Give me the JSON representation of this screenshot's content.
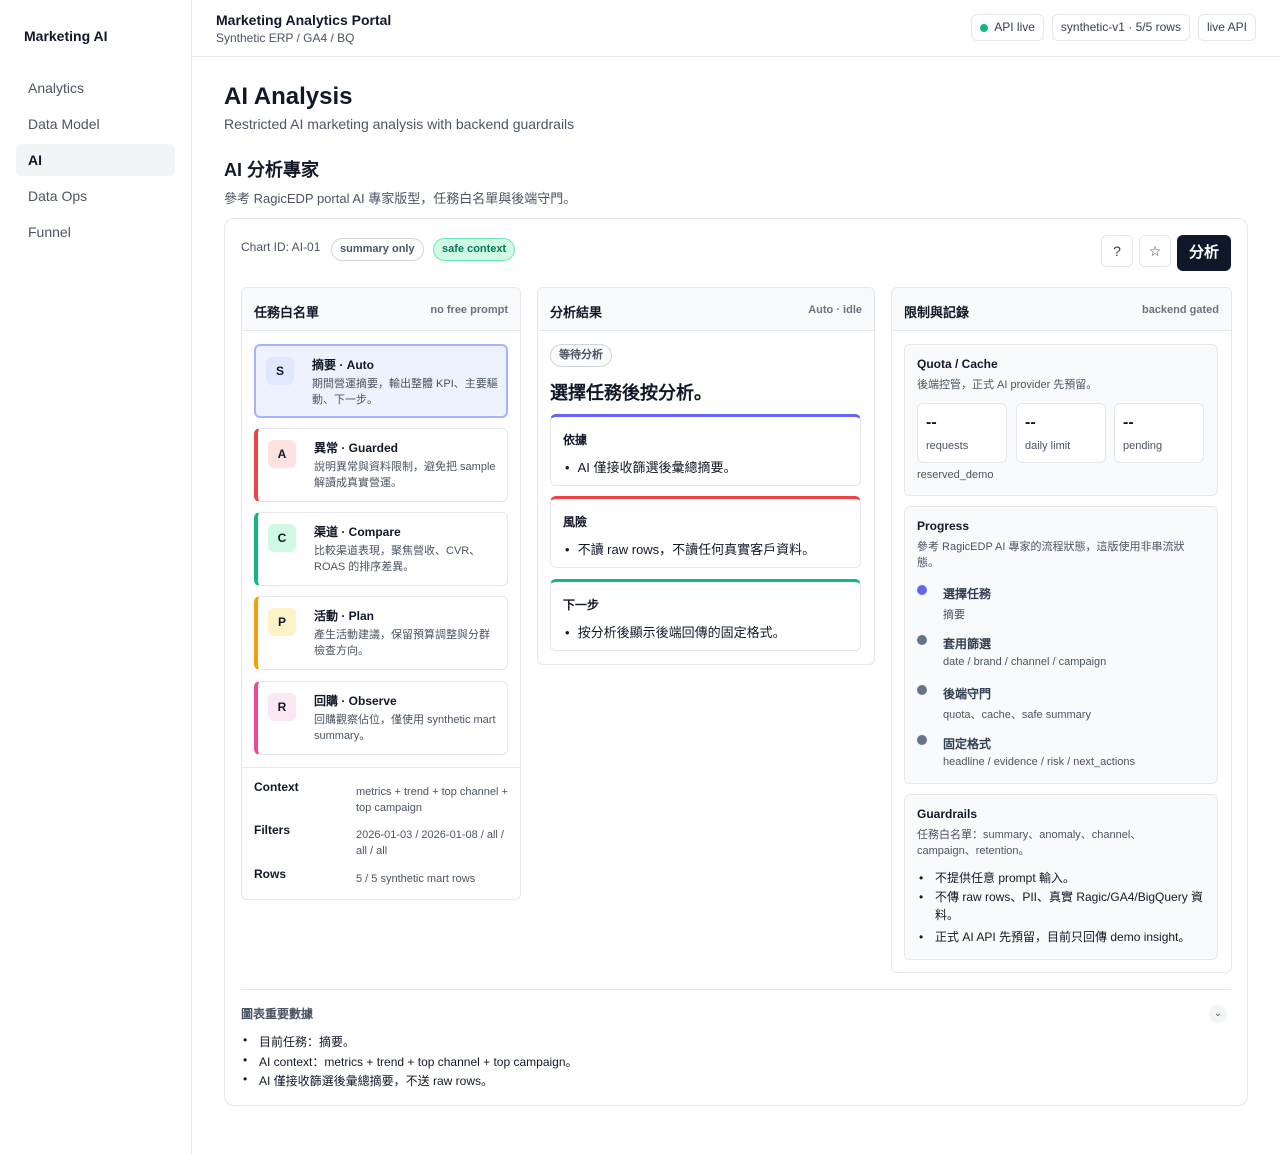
{
  "app": {
    "brand": "Marketing AI"
  },
  "sidebar": {
    "items": [
      {
        "label": "Analytics"
      },
      {
        "label": "Data Model"
      },
      {
        "label": "AI"
      },
      {
        "label": "Data Ops"
      },
      {
        "label": "Funnel"
      }
    ],
    "active_index": 2
  },
  "topbar": {
    "title": "Marketing Analytics Portal",
    "subtitle": "Synthetic ERP / GA4 / BQ",
    "status_live": "API live",
    "status_dataset": "synthetic-v1 · 5/5 rows",
    "status_mode": "live API",
    "live_color": "#10b981"
  },
  "page": {
    "title": "AI Analysis",
    "subtitle": "Restricted AI marketing analysis with backend guardrails",
    "section_title": "AI 分析專家",
    "section_subtitle": "參考 RagicEDP portal AI 專家版型，任務白名單與後端守門。"
  },
  "card": {
    "chart_id": "Chart ID: AI-01",
    "pill_summary": "summary only",
    "pill_safe": "safe context",
    "help_icon": "?",
    "star_icon": "☆",
    "analyze_label": "分析"
  },
  "tasks": {
    "title": "任務白名單",
    "hint": "no free prompt",
    "items": [
      {
        "badge": "S",
        "title": "摘要 · Auto",
        "desc": "期間營運摘要，輸出整體 KPI、主要驅動、下一步。",
        "color": "#6366f1",
        "badge_bg": "#e0e7ff"
      },
      {
        "badge": "A",
        "title": "異常 · Guarded",
        "desc": "說明異常與資料限制，避免把 sample 解讀成真實營運。",
        "color": "#ef4444",
        "badge_bg": "#fee2e2"
      },
      {
        "badge": "C",
        "title": "渠道 · Compare",
        "desc": "比較渠道表現，聚焦營收、CVR、ROAS 的排序差異。",
        "color": "#10b981",
        "badge_bg": "#d1fae5"
      },
      {
        "badge": "P",
        "title": "活動 · Plan",
        "desc": "產生活動建議，保留預算調整與分群檢查方向。",
        "color": "#f59e0b",
        "badge_bg": "#fef3c7"
      },
      {
        "badge": "R",
        "title": "回購 · Observe",
        "desc": "回購觀察佔位，僅使用 synthetic mart summary。",
        "color": "#ec4899",
        "badge_bg": "#fce7f3"
      }
    ],
    "context_label": "Context",
    "context_value": "metrics + trend + top channel + top campaign",
    "filters_label": "Filters",
    "filters_value": "2026-01-03 / 2026-01-08 / all / all / all",
    "rows_label": "Rows",
    "rows_value": "5 / 5 synthetic mart rows"
  },
  "result": {
    "title": "分析結果",
    "status": "Auto · idle",
    "state_pill": "等待分析",
    "headline": "選擇任務後按分析。",
    "boxes": [
      {
        "title": "依據",
        "item": "AI 僅接收篩選後彙總摘要。",
        "color": "#6366f1"
      },
      {
        "title": "風險",
        "item": "不讀 raw rows，不讀任何真實客戶資料。",
        "color": "#ef4444"
      },
      {
        "title": "下一步",
        "item": "按分析後顯示後端回傳的固定格式。",
        "color": "#10b981"
      }
    ]
  },
  "limits": {
    "title": "限制與記錄",
    "hint": "backend gated",
    "quota": {
      "title": "Quota / Cache",
      "desc": "後端控管，正式 AI provider 先預留。",
      "stats": [
        {
          "value": "--",
          "label": "requests"
        },
        {
          "value": "--",
          "label": "daily limit"
        },
        {
          "value": "--",
          "label": "pending"
        }
      ],
      "footer": "reserved_demo"
    },
    "progress": {
      "title": "Progress",
      "desc": "參考 RagicEDP AI 專家的流程狀態，這版使用非串流狀態。",
      "steps": [
        {
          "title": "選擇任務",
          "sub": "摘要",
          "color": "#6366f1"
        },
        {
          "title": "套用篩選",
          "sub": "date / brand / channel / campaign",
          "color": "#64748b"
        },
        {
          "title": "後端守門",
          "sub": "quota、cache、safe summary",
          "color": "#64748b"
        },
        {
          "title": "固定格式",
          "sub": "headline / evidence / risk / next_actions",
          "color": "#64748b"
        }
      ]
    },
    "guardrails": {
      "title": "Guardrails",
      "desc": "任務白名單：summary、anomaly、channel、campaign、retention。",
      "items": [
        "不提供任意 prompt 輸入。",
        "不傳 raw rows、PII、真實 Ragic/GA4/BigQuery 資料。",
        "正式 AI API 先預留，目前只回傳 demo insight。"
      ]
    }
  },
  "keydata": {
    "title": "圖表重要數據",
    "chevron_icon": "⌄",
    "items": [
      "目前任務：摘要。",
      "AI context：metrics + trend + top channel + top campaign。",
      "AI 僅接收篩選後彙總摘要，不送 raw rows。"
    ]
  }
}
